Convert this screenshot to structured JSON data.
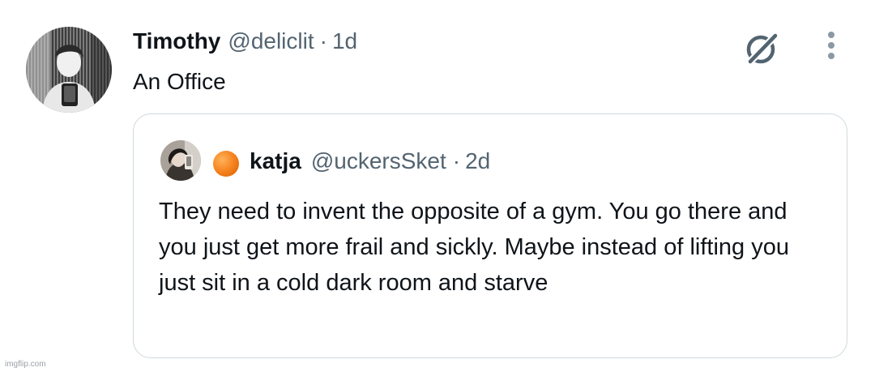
{
  "tweet": {
    "author_name": "Timothy",
    "author_handle": "@deliclit",
    "separator": "·",
    "time": "1d",
    "text": "An Office",
    "avatar_icon": "user-avatar-photo",
    "actions": {
      "grok_icon": "grok-slash-circle-icon",
      "more_icon": "vertical-ellipsis-icon"
    }
  },
  "quoted_tweet": {
    "author_name": "katja",
    "author_handle": "@uckersSket",
    "separator": "·",
    "time": "2d",
    "name_emoji": "orange-circle-emoji",
    "avatar_icon": "user-avatar-photo",
    "text": "They need to invent the opposite of a gym. You go there and you just get more frail and sickly. Maybe instead of lifting you just sit in a cold dark room and starve"
  },
  "watermark": "imgflip.com",
  "colors": {
    "text_primary": "#0f1419",
    "text_secondary": "#536471",
    "border": "#cfd9de",
    "emoji_orange": "#f5841f"
  }
}
